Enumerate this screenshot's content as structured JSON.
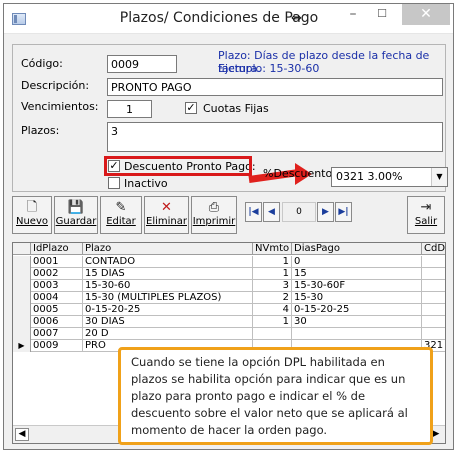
{
  "window": {
    "title": "Plazos/ Condiciones de Pago"
  },
  "form": {
    "codigo_label": "Código:",
    "codigo_value": "0009",
    "hint_line1": "Plazo: Días de plazo desde la fecha de factura.",
    "hint_line2": "Ejemplo: 15-30-60",
    "descripcion_label": "Descripción:",
    "descripcion_value": "PRONTO PAGO",
    "vencimientos_label": "Vencimientos:",
    "vencimientos_value": "1",
    "cuotas_fijas_label": "Cuotas Fijas",
    "cuotas_fijas_checked": true,
    "plazos_label": "Plazos:",
    "plazos_value": "3",
    "descuento_label": "Descuento Pronto Pago:",
    "descuento_checked": true,
    "inactivo_label": "Inactivo",
    "inactivo_checked": false,
    "pct_descuento_label": "%Descuento:",
    "pct_descuento_value": "0321  3.00%"
  },
  "toolbar": {
    "nuevo": "Nuevo",
    "guardar": "Guardar",
    "editar": "Editar",
    "eliminar": "Eliminar",
    "imprimir": "Imprimir",
    "nav_position": "0",
    "salir": "Salir"
  },
  "grid": {
    "headers": [
      "IdPlazo",
      "Plazo",
      "NVmto",
      "DiasPago",
      "CdD"
    ],
    "rows": [
      [
        "0001",
        "CONTADO",
        "1",
        "0",
        ""
      ],
      [
        "0002",
        "15 DÍAS",
        "1",
        "15",
        ""
      ],
      [
        "0003",
        "15-30-60",
        "3",
        "15-30-60F",
        ""
      ],
      [
        "0004",
        "15-30 (MULTIPLES PLAZOS)",
        "2",
        "15-30",
        ""
      ],
      [
        "0005",
        "0-15-20-25",
        "4",
        "0-15-20-25",
        ""
      ],
      [
        "0006",
        "30 DIAS",
        "1",
        "30",
        ""
      ],
      [
        "0007",
        "20 D",
        "",
        "",
        ""
      ],
      [
        "0009",
        "PRO",
        "",
        "",
        "321"
      ]
    ],
    "selected_row_index": 7
  },
  "callout": {
    "text": "Cuando se tiene la opción DPL habilitada en plazos se habilita opción para indicar que es un plazo para pronto pago e indicar  el % de descuento sobre el valor neto que se aplicará al momento de hacer la orden pago."
  },
  "colors": {
    "highlight_red": "#d9191a",
    "callout_border": "#f0a119",
    "hint_blue": "#1a2fa8"
  }
}
